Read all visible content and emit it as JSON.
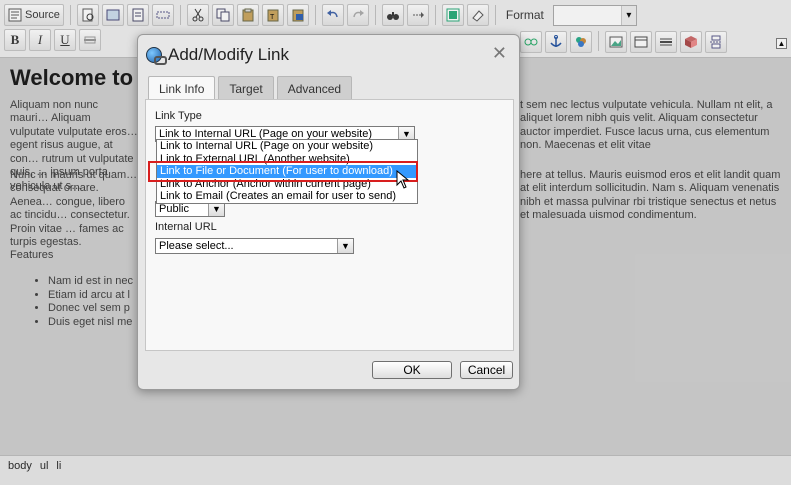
{
  "toolbar": {
    "source_label": "Source",
    "format_label": "Format",
    "format_value": ""
  },
  "editor": {
    "heading": "Welcome to",
    "paragraph1": "Aliquam non nunc mauri… Aliquam vulputate vulputate eros… egent risus augue, at con… rutrum ut vulputate quis, … ipsum porta vehicula ut s…",
    "paragraph1_right": "t sem nec lectus vulputate vehicula. Nullam nt elit, a aliquet lorem nibh quis velit. Aliquam consectetur auctor imperdiet. Fusce lacus urna, cus elementum non. Maecenas et elit vitae",
    "paragraph2": "Nunc in mauris ut quam… consequat ornare. Aenea… congue, libero ac tincidu… consectetur. Proin vitae … fames ac turpis egestas.",
    "paragraph2_right": "here at tellus. Mauris euismod eros et elit landit quam at elit interdum sollicitudin. Nam s. Aliquam venenatis nibh et massa pulvinar rbi tristique senectus et netus et malesuada uismod condimentum.",
    "features_heading": "Features",
    "features": [
      "Nam id est in nec",
      "Etiam id arcu at l",
      "Donec vel sem p",
      "Duis eget nisl me"
    ]
  },
  "statusbar": {
    "path": [
      "body",
      "ul",
      "li"
    ]
  },
  "dialog": {
    "title": "Add/Modify Link",
    "tabs": [
      "Link Info",
      "Target",
      "Advanced"
    ],
    "link_type_label": "Link Type",
    "link_type_value": "Link to Internal URL (Page on your website)",
    "link_type_options": [
      "Link to Internal URL (Page on your website)",
      "Link to External URL (Another website)",
      "Link to File or Document (For user to download)",
      "Link to Anchor (Anchor within current page)",
      "Link to Email (Creates an email for user to send)"
    ],
    "selected_option_index": 2,
    "public_value": "Public",
    "internal_url_label": "Internal URL",
    "internal_url_value": "Please select...",
    "ok_label": "OK",
    "cancel_label": "Cancel"
  }
}
